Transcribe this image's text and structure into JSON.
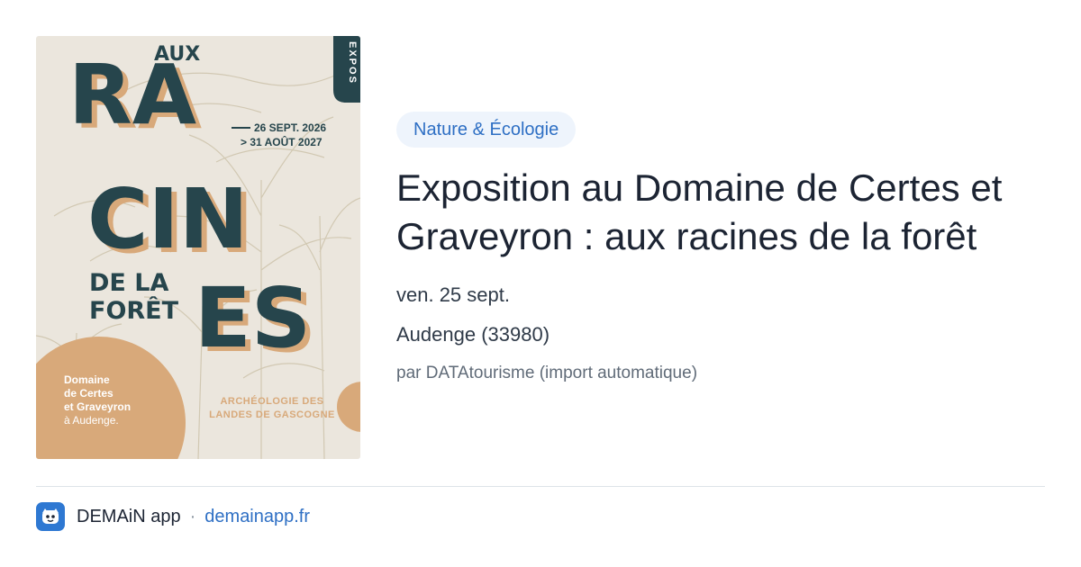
{
  "poster": {
    "title_words": [
      "AUX",
      "RA",
      "CIN",
      "ES",
      "DE LA",
      "FORÊT"
    ],
    "badge_text": "EXPOS",
    "date_start": "26 SEPT. 2026",
    "date_end": "> 31 AOÛT 2027",
    "venue_lines": [
      "Domaine",
      "de Certes",
      "et Graveyron",
      "à Audenge."
    ],
    "subtitle_lines": [
      "ARCHÉOLOGIE DES",
      "LANDES DE GASCOGNE"
    ],
    "colors": {
      "background": "#ebe6dd",
      "dark": "#26454c",
      "accent": "#d8a97a",
      "tree": "#c8bea7"
    }
  },
  "category": "Nature & Écologie",
  "title": "Exposition au Domaine de Certes et Graveyron : aux racines de la forêt",
  "date": "ven. 25 sept.",
  "location": "Audenge (33980)",
  "source": "par DATAtourisme (import automatique)",
  "footer": {
    "app_name": "DEMAiN app",
    "separator": "·",
    "link": "demainapp.fr",
    "icon": "demain-app-logo-icon"
  }
}
